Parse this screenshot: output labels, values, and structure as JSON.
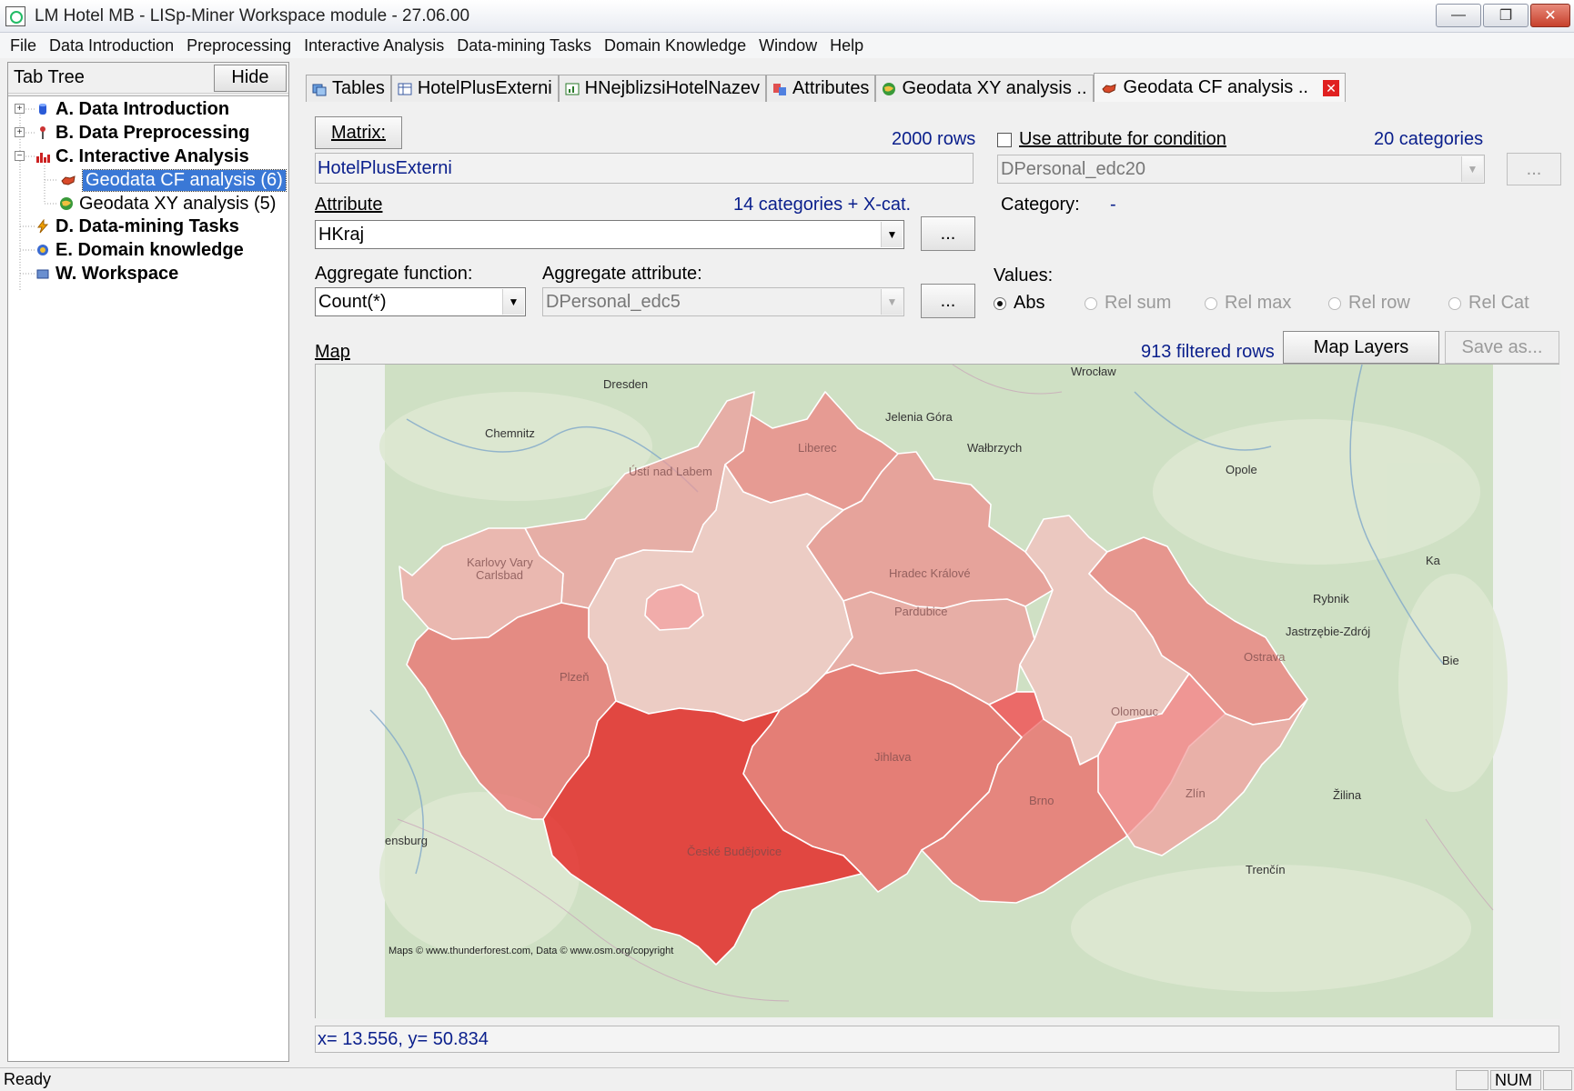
{
  "window": {
    "title": "LM Hotel MB - LISp-Miner Workspace module - 27.06.00",
    "minimize_glyph": "—",
    "maximize_glyph": "❐",
    "close_glyph": "✕"
  },
  "menu": [
    "File",
    "Data Introduction",
    "Preprocessing",
    "Interactive Analysis",
    "Data-mining Tasks",
    "Domain Knowledge",
    "Window",
    "Help"
  ],
  "tabtree": {
    "label": "Tab Tree",
    "hide_button": "Hide",
    "nodes": [
      {
        "label": "A. Data Introduction",
        "icon": "database-icon",
        "bold": true
      },
      {
        "label": "B. Data Preprocessing",
        "icon": "wrench-icon",
        "bold": true
      },
      {
        "label": "C. Interactive Analysis",
        "icon": "bar-chart-icon",
        "bold": true
      },
      {
        "label": "Geodata CF analysis (6)",
        "icon": "map-icon",
        "bold": false,
        "selected": true
      },
      {
        "label": "Geodata XY analysis (5)",
        "icon": "globe-icon",
        "bold": false
      },
      {
        "label": "D. Data-mining Tasks",
        "icon": "lightning-icon",
        "bold": true
      },
      {
        "label": "E. Domain knowledge",
        "icon": "knowledge-icon",
        "bold": true
      },
      {
        "label": "W. Workspace",
        "icon": "workspace-icon",
        "bold": true
      }
    ]
  },
  "tabs": [
    {
      "label": "Tables",
      "icon": "tables-icon"
    },
    {
      "label": "HotelPlusExterni",
      "icon": "table-icon"
    },
    {
      "label": "HNejblizsiHotelNazev",
      "icon": "chart-icon"
    },
    {
      "label": "Attributes",
      "icon": "attributes-icon"
    },
    {
      "label": "Geodata XY analysis ..",
      "icon": "globe-icon"
    },
    {
      "label": "Geodata CF analysis ..",
      "icon": "map-icon",
      "active": true
    }
  ],
  "form": {
    "matrix_button": "Matrix:",
    "rows_count": "2000 rows",
    "matrix_value": "HotelPlusExterni",
    "use_attribute_label": "Use attribute for condition",
    "use_attribute_checked": false,
    "condition_categories": "20 categories",
    "condition_value": "DPersonal_edc20",
    "condition_button": "...",
    "attribute_label": "Attribute",
    "attribute_categories": "14 categories + X-cat.",
    "attribute_value": "HKraj",
    "attribute_button": "...",
    "category_label": "Category:",
    "category_value": "-",
    "aggregate_function_label": "Aggregate function:",
    "aggregate_function_value": "Count(*)",
    "aggregate_attribute_label": "Aggregate attribute:",
    "aggregate_attribute_value": "DPersonal_edc5",
    "aggregate_button": "...",
    "values_label": "Values:",
    "values_options": [
      {
        "label": "Abs",
        "selected": true
      },
      {
        "label": "Rel sum",
        "selected": false
      },
      {
        "label": "Rel max",
        "selected": false
      },
      {
        "label": "Rel row",
        "selected": false
      },
      {
        "label": "Rel Cat",
        "selected": false
      }
    ],
    "map_label": "Map",
    "filtered_rows": "913 filtered rows",
    "map_layers_button": "Map Layers",
    "save_as_button": "Save as..."
  },
  "map": {
    "attribution": "Maps © www.thunderforest.com, Data © www.osm.org/copyright",
    "cities": [
      "Dresden",
      "Wrocław",
      "Chemnitz",
      "Jelenia Góra",
      "Wałbrzych",
      "Opole",
      "Liberec",
      "Ústí nad Labem",
      "Karlovy Vary",
      "Carlsbad",
      "Hradec Králové",
      "Pardubice",
      "Plzeň",
      "Rybnik",
      "Jastrzębie-Zdrój",
      "Ostrava",
      "Olomouc",
      "Jihlava",
      "České Budějovice",
      "Brno",
      "Zlín",
      "Žilina",
      "Trenčín",
      "ensburg",
      "Ka",
      "Bie"
    ],
    "regions": [
      {
        "name": "Ústí nad Labem",
        "color": "#ef9a9a",
        "opacity": 0.72
      },
      {
        "name": "Liberec",
        "color": "#ef7f7f",
        "opacity": 0.72
      },
      {
        "name": "Karlovy Vary",
        "color": "#f4a8a8",
        "opacity": 0.72
      },
      {
        "name": "Hradec Králové",
        "color": "#ef8b8b",
        "opacity": 0.72
      },
      {
        "name": "Středočeský",
        "color": "#f6c4c4",
        "opacity": 0.72
      },
      {
        "name": "Praha",
        "color": "#f2a0a0",
        "opacity": 0.72
      },
      {
        "name": "Pardubice",
        "color": "#f09a9a",
        "opacity": 0.72
      },
      {
        "name": "Plzeň",
        "color": "#ec6a6a",
        "opacity": 0.72
      },
      {
        "name": "Olomouc",
        "color": "#f5bebe",
        "opacity": 0.72
      },
      {
        "name": "Ostrava",
        "color": "#ee7878",
        "opacity": 0.72
      },
      {
        "name": "Jihlava",
        "color": "#eb5757",
        "opacity": 0.72
      },
      {
        "name": "Brno",
        "color": "#ed6262",
        "opacity": 0.72
      },
      {
        "name": "Zlín",
        "color": "#f29c9c",
        "opacity": 0.72
      },
      {
        "name": "České Budějovice",
        "color": "#e61c1c",
        "opacity": 0.78
      }
    ]
  },
  "coords": "x= 13.556, y= 50.834",
  "statusbar": {
    "text": "Ready",
    "num": "NUM"
  }
}
